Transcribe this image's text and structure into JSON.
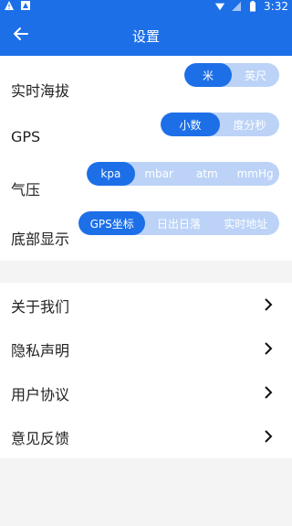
{
  "status": {
    "time": "3:32"
  },
  "appbar": {
    "title": "设置"
  },
  "settings": {
    "altitude": {
      "label": "实时海拔",
      "options": [
        "米",
        "英尺"
      ]
    },
    "gps": {
      "label": "GPS",
      "options": [
        "小数",
        "度分秒"
      ]
    },
    "pressure": {
      "label": "气压",
      "options": [
        "kpa",
        "mbar",
        "atm",
        "mmHg"
      ]
    },
    "bottom": {
      "label": "底部显示",
      "options": [
        "GPS坐标",
        "日出日落",
        "实时地址"
      ]
    }
  },
  "links": [
    {
      "label": "关于我们"
    },
    {
      "label": "隐私声明"
    },
    {
      "label": "用户协议"
    },
    {
      "label": "意见反馈"
    }
  ],
  "colors": {
    "primary": "#1d6fe8",
    "segment_bg": "#bcd3f7",
    "page_bg": "#f4f4f4"
  }
}
